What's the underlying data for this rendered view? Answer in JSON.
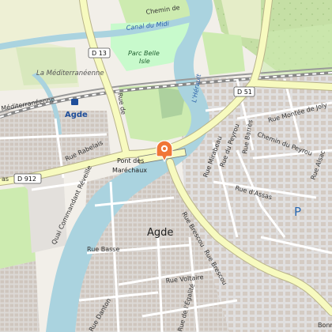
{
  "map": {
    "town_label": "Agde",
    "station_label": "Agde",
    "marker": {
      "name": "location-pin",
      "color": "#f07636"
    },
    "road_shields": [
      "D 13",
      "D 51",
      "D 912"
    ],
    "labels": {
      "canal": "Canal du Midi",
      "chemin_top": "Chemin de",
      "park": "Parc Belle Isle",
      "park_line1": "Parc Belle",
      "park_line2": "Isle",
      "mediterranee_italic": "La Méditerranéenne",
      "mediterranee_rail": "Méditerranéenne",
      "lherault": "L'Hérault",
      "rue_rabelais": "Rue Rabelais",
      "pont_line1": "Pont des",
      "pont_line2": "Maréchaux",
      "quai": "Quai Commandant Réveille",
      "rue_basse": "Rue Basse",
      "rue_voltaire": "Rue Voltaire",
      "rue_brescou_a": "Rue Brescou",
      "rue_brescou_b": "Rue Brescou",
      "rue_mirabeau": "Rue Mirabeau",
      "rue_peyrou": "Rue du Peyrou",
      "rue_barres": "Rue Barrès",
      "chemin_peyrou": "Chemin du Peyrou",
      "rue_assas": "Rue d'Assas",
      "rue_alsace": "Rue Alsac",
      "montee_joly": "Rue Montée de Joly",
      "rue_egalite": "Rue de l'Égalité",
      "rue_danton": "Rue Danton",
      "rue_bonne": "Bonne",
      "as_fragment": "as",
      "rue_vertical": "Rue de",
      "parking": "P"
    },
    "colors": {
      "water": "#aad3df",
      "park": "#c8facc",
      "grass": "#cdebb0",
      "road_primary": "#f7fabf",
      "road_casing": "#b8b38a",
      "residential": "#e0dfdf",
      "building": "#d9d0c9",
      "rail": "#777777",
      "farmland": "#eef0d5",
      "forest": "#add19e"
    }
  }
}
